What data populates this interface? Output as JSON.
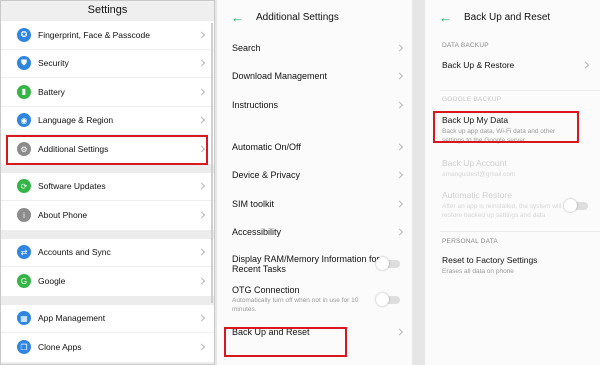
{
  "settings": {
    "title": "Settings",
    "groups": [
      [
        {
          "label": "Fingerprint, Face & Passcode",
          "icon": "fingerprint-icon",
          "color": "#2f86e0",
          "glyph": "✪"
        },
        {
          "label": "Security",
          "icon": "shield-icon",
          "color": "#2f86e0",
          "glyph": "⛊"
        },
        {
          "label": "Battery",
          "icon": "battery-icon",
          "color": "#35b548",
          "glyph": "▮"
        },
        {
          "label": "Language & Region",
          "icon": "globe-icon",
          "color": "#2f86e0",
          "glyph": "◉"
        },
        {
          "label": "Additional Settings",
          "icon": "gear-icon",
          "color": "#8c8c8c",
          "glyph": "⚙"
        }
      ],
      [
        {
          "label": "Software Updates",
          "icon": "update-icon",
          "color": "#35b548",
          "glyph": "⟳"
        },
        {
          "label": "About Phone",
          "icon": "info-icon",
          "color": "#8c8c8c",
          "glyph": "i"
        }
      ],
      [
        {
          "label": "Accounts and Sync",
          "icon": "sync-icon",
          "color": "#2f86e0",
          "glyph": "⇄"
        },
        {
          "label": "Google",
          "icon": "google-icon",
          "color": "#35b548",
          "glyph": "G"
        }
      ],
      [
        {
          "label": "App Management",
          "icon": "apps-icon",
          "color": "#2f86e0",
          "glyph": "▦"
        },
        {
          "label": "Clone Apps",
          "icon": "clone-icon",
          "color": "#2f86e0",
          "glyph": "❐"
        }
      ]
    ]
  },
  "additional": {
    "title": "Additional Settings",
    "section1": [
      "Search",
      "Download Management",
      "Instructions"
    ],
    "section2": [
      {
        "label": "Automatic On/Off"
      },
      {
        "label": "Device & Privacy"
      },
      {
        "label": "SIM toolkit"
      },
      {
        "label": "Accessibility"
      },
      {
        "label": "Display RAM/Memory Information for Recent Tasks",
        "toggle": true
      },
      {
        "label": "OTG Connection",
        "sub": "Automatically turn off when not in use for 10 minutes.",
        "toggle": true
      },
      {
        "label": "Back Up and Reset"
      }
    ]
  },
  "backup": {
    "title": "Back Up and Reset",
    "data_backup_caption": "DATA BACKUP",
    "backup_restore": "Back Up & Restore",
    "google_backup_caption": "GOOGLE BACKUP",
    "backup_my_data": "Back Up My Data",
    "backup_my_data_sub": "Back up app data, Wi-Fi data and other settings to the Google server",
    "backup_account": "Back Up Account",
    "backup_account_sub": "amangustest@gmail.com",
    "auto_restore": "Automatic Restore",
    "auto_restore_sub": "After an app is reinstalled, the system will restore backed up settings and data",
    "personal_caption": "PERSONAL DATA",
    "factory_reset": "Reset to Factory Settings",
    "factory_reset_sub": "Erases all data on phone"
  },
  "colors": {
    "accent": "#1aa564",
    "highlight": "#d8181f"
  }
}
